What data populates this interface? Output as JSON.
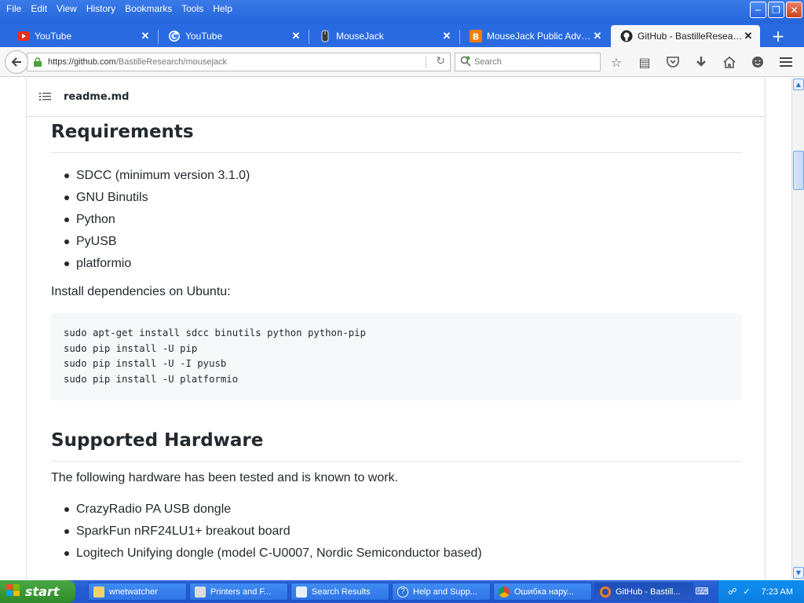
{
  "menu": [
    "File",
    "Edit",
    "View",
    "History",
    "Bookmarks",
    "Tools",
    "Help"
  ],
  "tabs": [
    {
      "title": "YouTube",
      "icon": "youtube-icon"
    },
    {
      "title": "YouTube",
      "icon": "google-icon"
    },
    {
      "title": "MouseJack",
      "icon": "mousejack-icon"
    },
    {
      "title": "MouseJack Public Advisori...",
      "icon": "blogger-icon"
    },
    {
      "title": "GitHub - BastilleResearch/...",
      "icon": "github-icon"
    }
  ],
  "nav": {
    "url_host": "https://github.com",
    "url_path": "/BastilleResearch/mousejack",
    "search_placeholder": "Search"
  },
  "readme": {
    "filename": "readme.md",
    "requirements_heading": "Requirements",
    "requirements": [
      "SDCC (minimum version 3.1.0)",
      "GNU Binutils",
      "Python",
      "PyUSB",
      "platformio"
    ],
    "install_intro": "Install dependencies on Ubuntu:",
    "code": [
      "sudo apt-get install sdcc binutils python python-pip",
      "sudo pip install -U pip",
      "sudo pip install -U -I pyusb",
      "sudo pip install -U platformio"
    ],
    "hardware_heading": "Supported Hardware",
    "hardware_intro": "The following hardware has been tested and is known to work.",
    "hardware": [
      "CrazyRadio PA USB dongle",
      "SparkFun nRF24LU1+ breakout board",
      "Logitech Unifying dongle (model C-U0007, Nordic Semiconductor based)"
    ]
  },
  "taskbar": {
    "start": "start",
    "tasks": [
      {
        "label": "wnetwatcher",
        "icon": "folder-icon"
      },
      {
        "label": "Printers and F...",
        "icon": "printer-icon"
      },
      {
        "label": "Search Results",
        "icon": "search-results-icon"
      },
      {
        "label": "Help and Supp...",
        "icon": "help-icon"
      },
      {
        "label": "Ошибка нару...",
        "icon": "chrome-icon"
      },
      {
        "label": "GitHub - Bastill...",
        "icon": "firefox-icon"
      }
    ],
    "time": "7:23 AM"
  },
  "colors": {
    "titlebar": "#2465db",
    "link_text": "#24292e",
    "code_bg": "#f6f8fa",
    "start_green": "#3c9a36"
  }
}
